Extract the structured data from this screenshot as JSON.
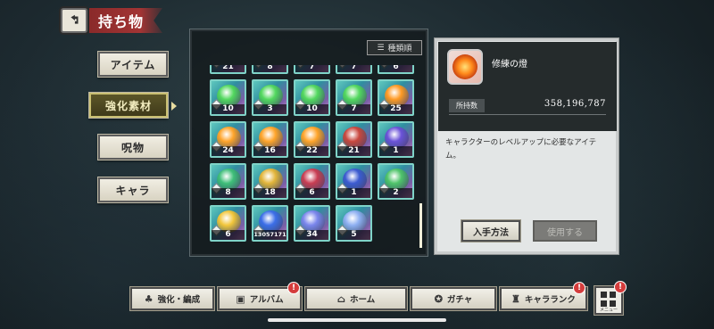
{
  "header": {
    "title": "持ち物"
  },
  "side_tabs": [
    {
      "label": "アイテム",
      "active": false
    },
    {
      "label": "強化素材",
      "active": true
    },
    {
      "label": "呪物",
      "active": false
    },
    {
      "label": "キャラ",
      "active": false
    }
  ],
  "sort": {
    "label": "種類順"
  },
  "grid": [
    {
      "qty": "21",
      "orb": "#4bd36a"
    },
    {
      "qty": "8",
      "orb": "#4bd36a"
    },
    {
      "qty": "7",
      "orb": "#4bd36a"
    },
    {
      "qty": "7",
      "orb": "#4bd36a"
    },
    {
      "qty": "6",
      "orb": "#ffa12a"
    },
    {
      "qty": "10",
      "orb": "#53d85f"
    },
    {
      "qty": "3",
      "orb": "#53d85f"
    },
    {
      "qty": "10",
      "orb": "#53d85f"
    },
    {
      "qty": "7",
      "orb": "#53d85f"
    },
    {
      "qty": "25",
      "orb": "#ff9a24"
    },
    {
      "qty": "24",
      "orb": "#ffa42a"
    },
    {
      "qty": "16",
      "orb": "#ffa42a"
    },
    {
      "qty": "22",
      "orb": "#ffa42a"
    },
    {
      "qty": "21",
      "orb": "#c9473e"
    },
    {
      "qty": "1",
      "orb": "#6b52d8"
    },
    {
      "qty": "8",
      "orb": "#3fbf79"
    },
    {
      "qty": "18",
      "orb": "#e3b53a"
    },
    {
      "qty": "6",
      "orb": "#c93d52"
    },
    {
      "qty": "1",
      "orb": "#3d5bd1"
    },
    {
      "qty": "2",
      "orb": "#4fc46a"
    },
    {
      "qty": "6",
      "orb": "#f2c63b"
    },
    {
      "qty": "13057171",
      "orb": "#3c6ee8"
    },
    {
      "qty": "34",
      "orb": "#7b86ec"
    },
    {
      "qty": "5",
      "orb": "#8fb0f2"
    }
  ],
  "detail": {
    "name": "修練の燈",
    "owned_label": "所持数",
    "owned_value": "358,196,787",
    "description": "キャラクターのレベルアップに必要なアイテム。",
    "obtain_label": "入手方法",
    "use_label": "使用する"
  },
  "nav": [
    {
      "label": "強化・編成",
      "icon": "group-icon",
      "alert": false
    },
    {
      "label": "アルバム",
      "icon": "album-icon",
      "alert": true
    },
    {
      "label": "ホーム",
      "icon": "home-icon",
      "alert": false
    },
    {
      "label": "ガチャ",
      "icon": "gacha-icon",
      "alert": false
    },
    {
      "label": "キャラランク",
      "icon": "rank-icon",
      "alert": true
    }
  ],
  "menu": {
    "label": "メニュー",
    "alert": true,
    "alert_mark": "!"
  }
}
